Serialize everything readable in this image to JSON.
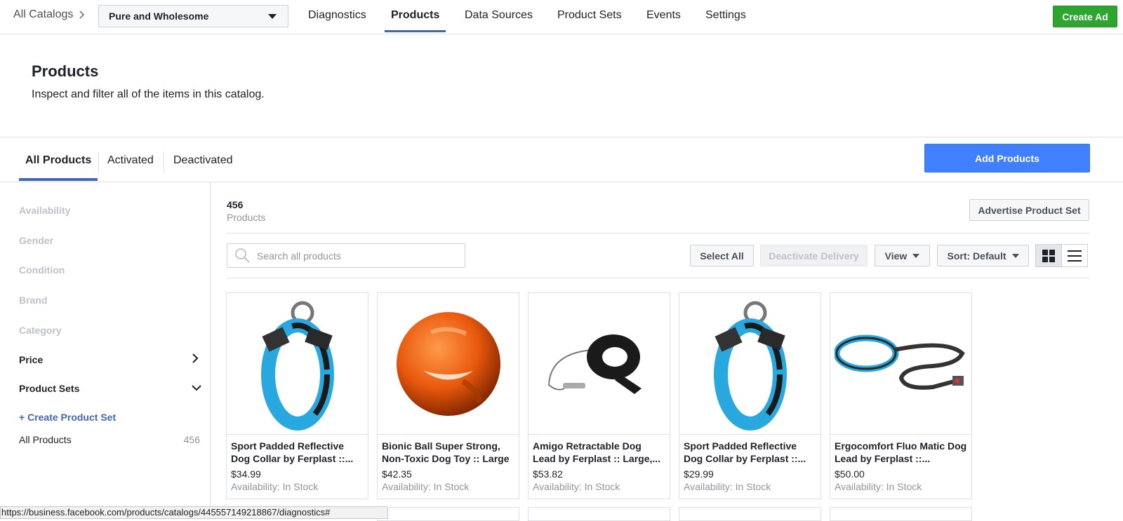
{
  "topnav": {
    "breadcrumb": "All Catalogs",
    "catalog": "Pure and Wholesome",
    "tabs": [
      "Diagnostics",
      "Products",
      "Data Sources",
      "Product Sets",
      "Events",
      "Settings"
    ],
    "active_tab": "Products",
    "create_ad": "Create Ad"
  },
  "header": {
    "title": "Products",
    "subtitle": "Inspect and filter all of the items in this catalog."
  },
  "subtabs": {
    "items": [
      "All Products",
      "Activated",
      "Deactivated"
    ],
    "active": "All Products",
    "add_products": "Add Products"
  },
  "sidebar": {
    "filters": [
      {
        "label": "Availability",
        "enabled": false
      },
      {
        "label": "Gender",
        "enabled": false
      },
      {
        "label": "Condition",
        "enabled": false
      },
      {
        "label": "Brand",
        "enabled": false
      },
      {
        "label": "Category",
        "enabled": false
      },
      {
        "label": "Price",
        "enabled": true,
        "icon": "chevron-right-icon"
      },
      {
        "label": "Product Sets",
        "enabled": true,
        "icon": "chevron-down-icon"
      }
    ],
    "create_set": "+ Create Product Set",
    "sets": [
      {
        "label": "All Products",
        "count": "456"
      }
    ]
  },
  "main": {
    "count": "456",
    "count_label": "Products",
    "advertise": "Advertise Product Set",
    "search_placeholder": "Search all products",
    "select_all": "Select All",
    "deactivate": "Deactivate Delivery",
    "view": "View",
    "sort": "Sort: Default"
  },
  "products": [
    {
      "name": "Sport Padded Reflective Dog Collar by Ferplast ::...",
      "price": "$34.99",
      "availability": "Availability: In Stock",
      "image": "collar"
    },
    {
      "name": "Bionic Ball Super Strong, Non-Toxic Dog Toy :: Large",
      "price": "$42.35",
      "availability": "Availability: In Stock",
      "image": "ball"
    },
    {
      "name": "Amigo Retractable Dog Lead by Ferplast :: Large,...",
      "price": "$53.82",
      "availability": "Availability: In Stock",
      "image": "leash-retractable"
    },
    {
      "name": "Sport Padded Reflective Dog Collar by Ferplast ::...",
      "price": "$29.99",
      "availability": "Availability: In Stock",
      "image": "collar"
    },
    {
      "name": "Ergocomfort Fluo Matic Dog Lead by Ferplast ::...",
      "price": "$50.00",
      "availability": "Availability: In Stock",
      "image": "lead"
    }
  ],
  "status_url": "https://business.facebook.com/products/catalogs/445557149218867/diagnostics#",
  "colors": {
    "accent": "#4267b2",
    "primary_button": "#4080ff",
    "create_ad": "#2ea52e",
    "collar": "#29a8e0",
    "ball": "#e8580c"
  }
}
